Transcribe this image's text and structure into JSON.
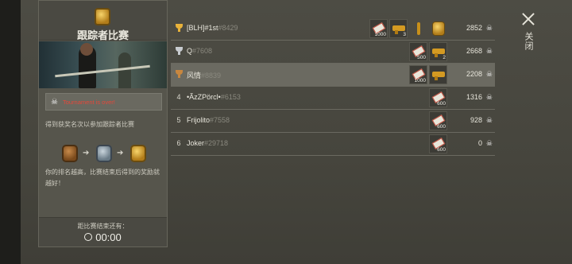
{
  "panel": {
    "title": "跟踪者比赛",
    "alert": "Tournament is over!",
    "hint": "得到获奖名次以参加跟踪者比赛",
    "tiers": [
      "bronze-medal-icon",
      "silver-medal-icon",
      "gold-medal-icon"
    ],
    "description": "你的排名越高，比赛结束后得到的奖励就越好！",
    "countdown_label": "距比赛结束还有：",
    "countdown": "00:00"
  },
  "close_label": "关闭",
  "leaderboard": [
    {
      "rank": "1",
      "trophy": "gold",
      "name": "[BLH]#1st",
      "tag": "#8429",
      "score": "2852",
      "rewards": [
        {
          "icon": "ticket-icon",
          "qty": "1000"
        },
        {
          "icon": "golden-gun-icon",
          "qty": "3"
        },
        {
          "icon": "torch-icon",
          "qty": ""
        },
        {
          "icon": "gold-medal-icon",
          "qty": ""
        }
      ]
    },
    {
      "rank": "2",
      "trophy": "silver",
      "name": "Q",
      "tag": "#7608",
      "score": "2668",
      "rewards": [
        {
          "icon": "ticket-icon",
          "qty": "500"
        },
        {
          "icon": "golden-gun-icon",
          "qty": "2"
        }
      ]
    },
    {
      "rank": "3",
      "trophy": "bronze",
      "name": "风情",
      "tag": "#8839",
      "score": "2208",
      "rewards": [
        {
          "icon": "ticket-icon",
          "qty": "1000"
        },
        {
          "icon": "golden-gun-icon",
          "qty": ""
        }
      ]
    },
    {
      "rank": "4",
      "trophy": "",
      "name": "•ÃzZPörcl•",
      "tag": "#6153",
      "score": "1316",
      "rewards": [
        {
          "icon": "ticket-icon",
          "qty": "600"
        }
      ]
    },
    {
      "rank": "5",
      "trophy": "",
      "name": "Frijolito",
      "tag": "#7558",
      "score": "928",
      "rewards": [
        {
          "icon": "ticket-icon",
          "qty": "600"
        }
      ]
    },
    {
      "rank": "6",
      "trophy": "",
      "name": "Joker",
      "tag": "#29718",
      "score": "0",
      "rewards": [
        {
          "icon": "ticket-icon",
          "qty": "600"
        }
      ]
    }
  ]
}
